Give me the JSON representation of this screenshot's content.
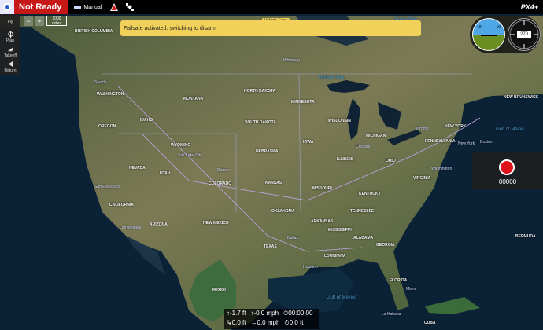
{
  "topbar": {
    "status": "Not Ready",
    "mode": "Manual",
    "brand": "PX4+"
  },
  "toolbar": {
    "items": [
      {
        "label": "Fly"
      },
      {
        "label": "Plan"
      },
      {
        "label": "Takeoff"
      },
      {
        "label": "Return"
      }
    ]
  },
  "map": {
    "scale": "1000 miles",
    "zoom_in": "+",
    "zoom_out": "−",
    "labels": {
      "james_bay": "James Bay",
      "hudson_bay": "Hudson Bay",
      "north_dakota": "NORTH DAKOTA",
      "minnesota": "MINNESOTA",
      "wisconsin": "WISCONSIN",
      "michigan": "MICHIGAN",
      "wyoming": "WYOMING",
      "colorado": "COLORADO",
      "arizona": "ARIZONA",
      "texas": "TEXAS",
      "california": "CALIFORNIA",
      "nevada": "NEVADA",
      "utah": "UTAH",
      "kansas": "KANSAS",
      "missouri": "MISSOURI",
      "iowa": "IOWA",
      "illinois": "ILLINOIS",
      "ohio": "OHIO",
      "pennsylvania": "PENNSYLVANIA",
      "new_york": "NEW YORK",
      "virginia": "VIRGINIA",
      "georgia": "GEORGIA",
      "florida": "FLORIDA",
      "gulf_of_mexico": "Gulf of Mexico",
      "maine": "Gulf of Maine",
      "washington": "WASHINGTON",
      "oregon": "OREGON",
      "montana": "MONTANA",
      "nebraska": "NEBRASKA",
      "oklahoma": "OKLAHOMA",
      "new_mexico": "NEW MEXICO",
      "louisiana": "LOUISIANA",
      "kentucky": "KENTUCKY",
      "tennessee": "TENNESSEE",
      "alabama": "ALABAMA",
      "mississippi": "MISSISSIPPI",
      "south_dakota": "SOUTH DAKOTA",
      "idaho": "IDAHO",
      "arkansas": "ARKANSAS",
      "boston": "Boston",
      "chicago": "Chicago",
      "toronto": "Toronto",
      "new_york_city": "New York",
      "washington_dc": "Washington",
      "los_angeles": "Los Angeles",
      "san_francisco": "San Francisco",
      "seattle": "Seattle",
      "dallas": "Dallas",
      "houston": "Houston",
      "miami": "Miami",
      "denver": "Denver",
      "salt_lake_city": "Salt Lake City",
      "mexico": "Mexico",
      "bermuda": "BERMUDA",
      "new_brunswick": "NEW BRUNSWICK",
      "british_columbia": "BRITISH COLUMBIA",
      "winnipeg": "Winnipeg",
      "la_habana": "La Habana",
      "cuba": "CUBA"
    }
  },
  "alert": {
    "tab": "Vehicle Error",
    "message": "Failsafe activated: switching to disarm"
  },
  "instruments": {
    "pitch_left": "10",
    "pitch_right": "10",
    "heading": "270"
  },
  "camera": {
    "counter": "00000"
  },
  "telemetry": {
    "row1": [
      {
        "icon": "↑",
        "value": "-1.7 ft"
      },
      {
        "icon": "↑",
        "value": "-0.0 mph"
      },
      {
        "icon": "⏱",
        "value": "00:00:00"
      }
    ],
    "row2": [
      {
        "icon": "↳",
        "value": "0.0 ft"
      },
      {
        "icon": "→",
        "value": "0.0 mph"
      },
      {
        "icon": "⏱",
        "value": "0.0 ft"
      }
    ]
  },
  "colors": {
    "status_red": "#c71818",
    "alert_yellow": "#f2d15a",
    "record_red": "#e0121b"
  }
}
